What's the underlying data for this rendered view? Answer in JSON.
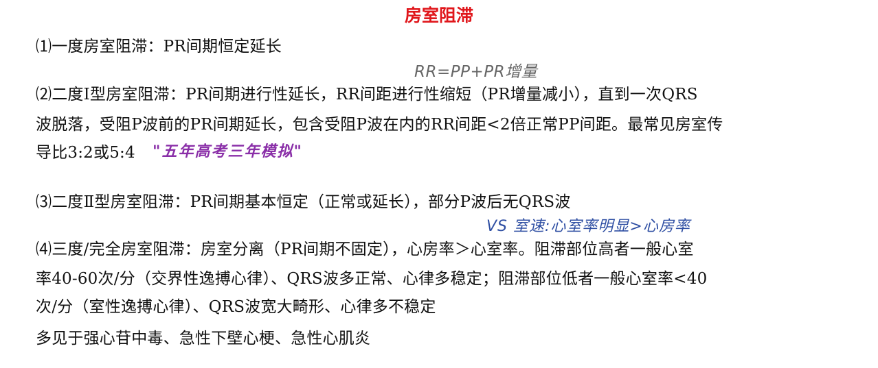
{
  "title": "房室阻滞",
  "lines": [
    "⑴一度房室阻滞：PR间期恒定延长",
    "⑵二度Ⅰ型房室阻滞：PR间期进行性延长，RR间距进行性缩短（PR增量减小），直到一次QRS",
    "波脱落，受阻P波前的PR间期延长，包含受阻P波在内的RR间距<2倍正常PP间距。最常见房室传",
    "导比3:2或5:4",
    "⑶二度Ⅱ型房室阻滞：PR间期基本恒定（正常或延长），部分P波后无QRS波",
    "⑷三度/完全房室阻滞：房室分离（PR间期不固定），心房率＞心室率。阻滞部位高者一般心室",
    "率40-60次/分（交界性逸搏心律）、QRS波多正常、心律多稳定；阻滞部位低者一般心室率<40",
    "次/分（室性逸搏心律）、QRS波宽大畸形、心律多不稳定",
    "多见于强心苷中毒、急性下壁心梗、急性心肌炎"
  ],
  "notes": {
    "rr_formula": "RR=PP+PR增量",
    "source": "\"五年高考三年模拟\"",
    "vs": "VS  室速:心室率明显>心房率"
  },
  "colors": {
    "title": "#e0161b",
    "note_gray": "#666666",
    "note_purple": "#8a2fa8",
    "note_blue": "#2f4fa3"
  }
}
